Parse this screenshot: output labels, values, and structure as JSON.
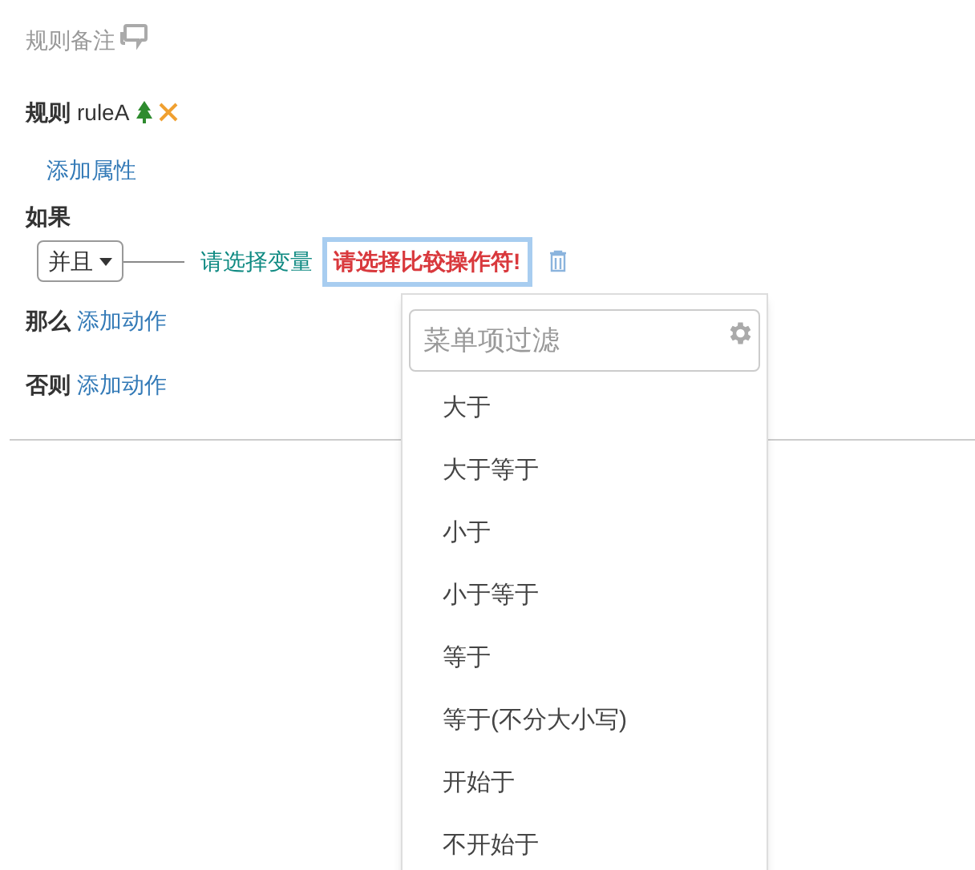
{
  "remark": {
    "label": "规则备注"
  },
  "rule": {
    "label": "规则",
    "name": "ruleA"
  },
  "add_property": "添加属性",
  "if": {
    "label": "如果",
    "junction": "并且",
    "variable": "请选择变量",
    "operator": "请选择比较操作符!"
  },
  "then": {
    "label": "那么",
    "action": "添加动作"
  },
  "else": {
    "label": "否则",
    "action": "添加动作"
  },
  "dropdown": {
    "filter": {
      "placeholder": "菜单项过滤"
    },
    "items": [
      "大于",
      "大于等于",
      "小于",
      "小于等于",
      "等于",
      "等于(不分大小写)",
      "开始于",
      "不开始于"
    ]
  }
}
